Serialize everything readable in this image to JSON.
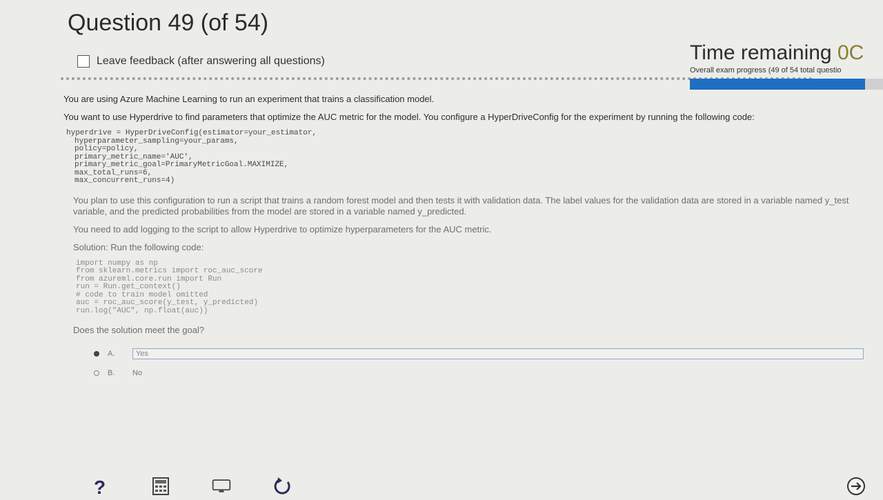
{
  "header": {
    "title": "Question 49 (of 54)",
    "feedback_label": "Leave feedback (after answering all questions)"
  },
  "timer": {
    "label": "Time remaining",
    "value": "0C",
    "progress_label": "Overall exam progress (49 of 54 total questio",
    "progress_fraction": 0.907
  },
  "question": {
    "p1": "You are using Azure Machine Learning to run an experiment that trains a classification model.",
    "p2": "You want to use Hyperdrive to find parameters that optimize the AUC metric for the model. You configure a HyperDriveConfig for the experiment by running the following code:",
    "code1": [
      "hyperdrive = HyperDriveConfig(estimator=your_estimator,",
      "hyperparameter_sampling=your_params,",
      "policy=policy,",
      "primary_metric_name='AUC',",
      "primary_metric_goal=PrimaryMetricGoal.MAXIMIZE,",
      "max_total_runs=6,",
      "max_concurrent_runs=4)"
    ],
    "p3": "You plan to use this configuration to run a script that trains a random forest model and then tests it with validation data. The label values for the validation data are stored in a variable named y_test variable, and the predicted probabilities from the model are stored in a variable named y_predicted.",
    "p4": "You need to add logging to the script to allow Hyperdrive to optimize hyperparameters for the AUC metric.",
    "p5": "Solution: Run the following code:",
    "code2": [
      "import numpy as np",
      "from sklearn.metrics import roc_auc_score",
      "from azureml.core.run import Run",
      "run = Run.get_context()",
      "# code to train model omitted",
      "auc = roc_auc_score(y_test, y_predicted)",
      "run.log(\"AUC\", np.float(auc))"
    ],
    "p6": "Does the solution meet the goal?"
  },
  "options": [
    {
      "letter": "A.",
      "text": "Yes",
      "selected": true
    },
    {
      "letter": "B.",
      "text": "No",
      "selected": false
    }
  ],
  "icons": {
    "help": "question-mark-icon",
    "calculator": "calculator-icon",
    "monitor": "monitor-icon",
    "refresh": "refresh-icon",
    "next": "next-arrow-icon"
  },
  "colors": {
    "accent": "#1e6fc3",
    "background": "#ecece9"
  }
}
